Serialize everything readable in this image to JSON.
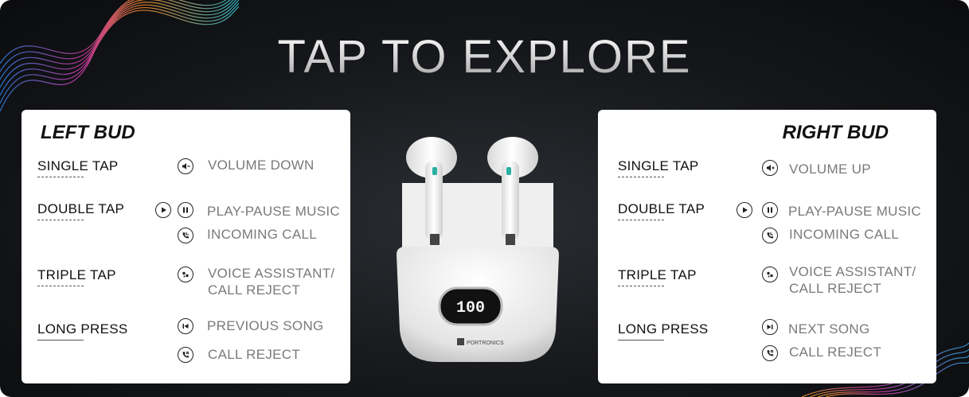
{
  "title": "TAP TO EXPLORE",
  "left": {
    "title": "LEFT BUD",
    "gestures": {
      "single": "SINGLE TAP",
      "double": "DOUBLE TAP",
      "triple": "TRIPLE TAP",
      "long": "LONG PRESS"
    },
    "actions": {
      "volume": "VOLUME DOWN",
      "play": "PLAY-PAUSE MUSIC",
      "incoming": "INCOMING CALL",
      "voice_1": "VOICE ASSISTANT/",
      "voice_2": "CALL REJECT",
      "song": "PREVIOUS SONG",
      "reject": "CALL REJECT"
    }
  },
  "right": {
    "title": "RIGHT BUD",
    "gestures": {
      "single": "SINGLE TAP",
      "double": "DOUBLE TAP",
      "triple": "TRIPLE TAP",
      "long": "LONG PRESS"
    },
    "actions": {
      "volume": "VOLUME UP",
      "play": "PLAY-PAUSE MUSIC",
      "incoming": "INCOMING CALL",
      "voice_1": "VOICE ASSISTANT/",
      "voice_2": "CALL REJECT",
      "song": "NEXT SONG",
      "reject": "CALL REJECT"
    }
  },
  "product": {
    "brand": "PORTRONICS",
    "display": "100"
  },
  "icons": [
    "volume-down-icon",
    "volume-up-icon",
    "play-icon",
    "pause-icon",
    "incoming-call-icon",
    "voice-assistant-icon",
    "previous-song-icon",
    "next-song-icon",
    "call-reject-icon"
  ]
}
